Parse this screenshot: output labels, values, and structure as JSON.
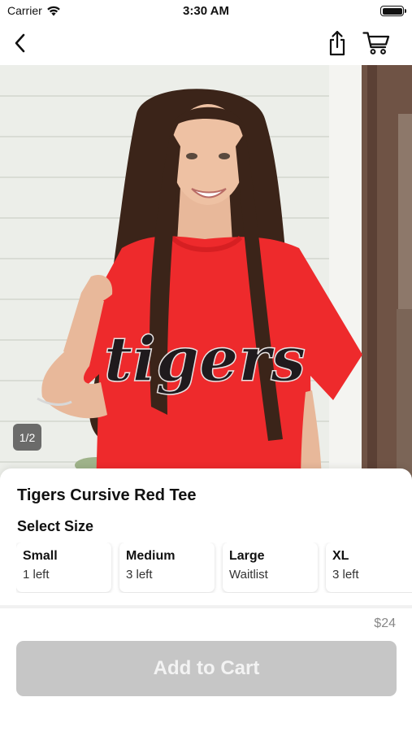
{
  "status_bar": {
    "carrier": "Carrier",
    "time": "3:30 AM",
    "wifi_icon": "wifi-icon",
    "battery_icon": "battery-full-icon"
  },
  "nav": {
    "back_icon": "chevron-left-icon",
    "share_icon": "share-icon",
    "cart_icon": "shopping-cart-icon"
  },
  "gallery": {
    "indicator": "1/2",
    "shirt_print": "tigers"
  },
  "product": {
    "title": "Tigers Cursive Red Tee",
    "size_heading": "Select Size",
    "sizes": [
      {
        "name": "Small",
        "stock": "1 left"
      },
      {
        "name": "Medium",
        "stock": "3 left"
      },
      {
        "name": "Large",
        "stock": "Waitlist"
      },
      {
        "name": "XL",
        "stock": "3 left"
      }
    ],
    "price": "$24",
    "add_to_cart_label": "Add to Cart"
  },
  "colors": {
    "shirt_red": "#ee2a2c",
    "button_disabled": "#c6c6c6",
    "button_text": "#f3f3f3",
    "price_text": "#888888"
  }
}
